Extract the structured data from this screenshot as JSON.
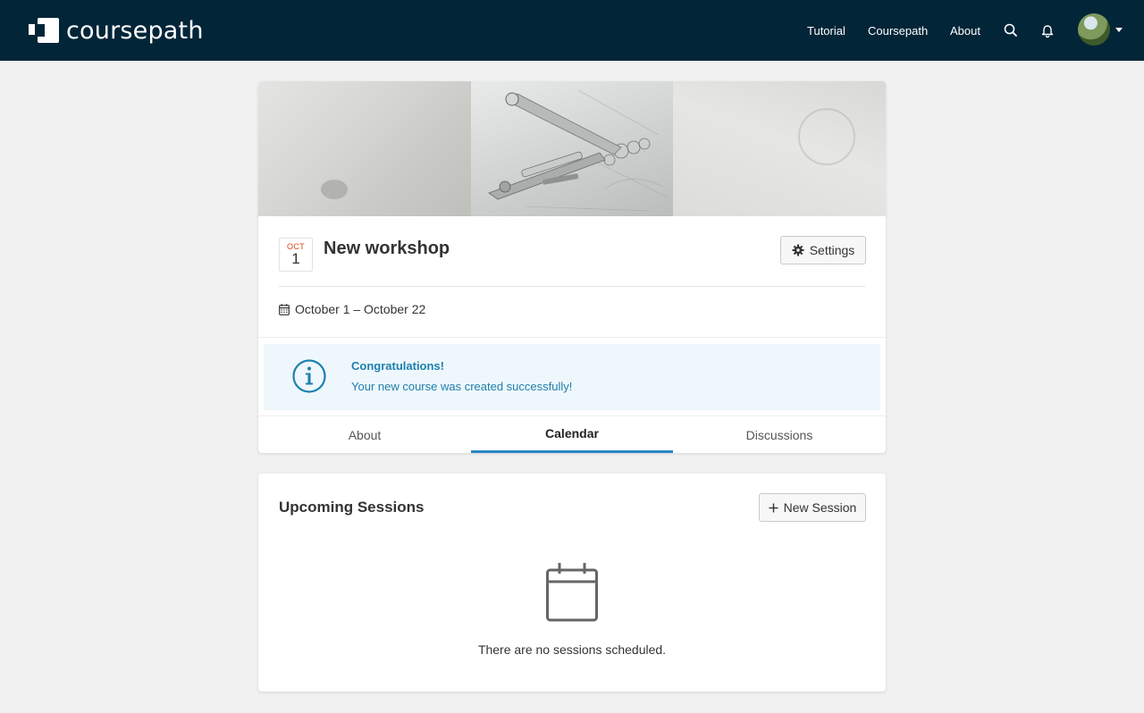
{
  "brand": {
    "name": "coursepath",
    "icon": "coursepath-logo-icon"
  },
  "nav": {
    "links": [
      "Tutorial",
      "Coursepath",
      "About"
    ],
    "search_icon": "search-icon",
    "bell_icon": "bell-icon",
    "avatar_icon": "avatar",
    "caret_icon": "caret-down-icon"
  },
  "course": {
    "date_month": "OCT",
    "date_day": "1",
    "title": "New workshop",
    "settings_label": "Settings",
    "date_range": "October 1 – October 22",
    "alert": {
      "title": "Congratulations!",
      "message": "Your new course was created successfully!"
    },
    "tabs": [
      {
        "label": "About",
        "active": false
      },
      {
        "label": "Calendar",
        "active": true
      },
      {
        "label": "Discussions",
        "active": false
      }
    ]
  },
  "sessions": {
    "title": "Upcoming Sessions",
    "new_session_label": "New Session",
    "empty_text": "There are no sessions scheduled."
  },
  "colors": {
    "topbar": "#022538",
    "accent": "#2a86c4",
    "alert_text": "#1d7fae",
    "alert_bg": "#eef7fb",
    "date_month": "#d9461e"
  }
}
